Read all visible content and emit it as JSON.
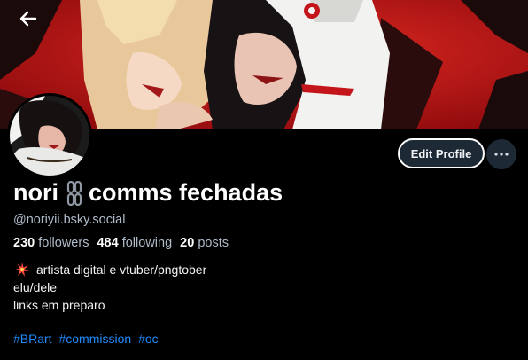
{
  "header": {
    "back_icon": "arrow-left-icon",
    "banner_colors": {
      "primary": "#c3151a",
      "dark": "#1a0a0a",
      "light": "#f2f2f0"
    }
  },
  "profile": {
    "display_name": "nori",
    "display_name_icon": "chain-link-icon",
    "display_name_suffix": "comms fechadas",
    "handle": "@noriyii.bsky.social",
    "stats": {
      "followers_count": "230",
      "followers_label": "followers",
      "following_count": "484",
      "following_label": "following",
      "posts_count": "20",
      "posts_label": "posts"
    },
    "bio": {
      "line1_icon": "sparkle-icon",
      "line1": "artista digital e vtuber/pngtober",
      "line2": "elu/dele",
      "line3": "links em preparo"
    },
    "hashtags": [
      "#BRart",
      "#commission",
      "#oc"
    ]
  },
  "actions": {
    "edit_profile_label": "Edit Profile",
    "more_icon": "ellipsis-icon"
  },
  "colors": {
    "background": "#000000",
    "button_bg": "#1e2936",
    "muted_text": "#aebbc9",
    "link": "#208bfe"
  }
}
